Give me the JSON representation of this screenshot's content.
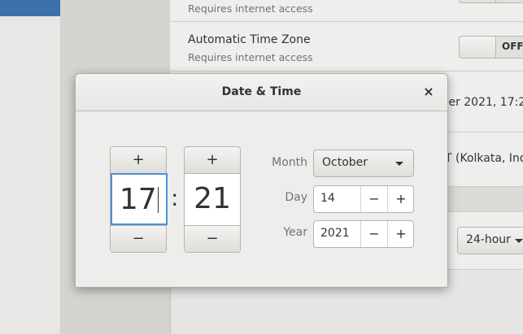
{
  "background": {
    "rows": [
      {
        "subtitle": "Requires internet access"
      },
      {
        "title": "Automatic Time Zone",
        "subtitle": "Requires internet access",
        "switch": "OFF"
      }
    ],
    "date_time_value": "ober 2021, 17:2",
    "timezone_value": "T (Kolkata, Indi",
    "time_format": "24-hour"
  },
  "dialog": {
    "title": "Date & Time",
    "close_glyph": "×",
    "time": {
      "hour": "17",
      "minute": "21",
      "separator": ":",
      "increment_glyph": "+",
      "decrement_glyph": "−"
    },
    "fields": {
      "month_label": "Month",
      "month_value": "October",
      "day_label": "Day",
      "day_value": "14",
      "year_label": "Year",
      "year_value": "2021",
      "minus_glyph": "−",
      "plus_glyph": "+"
    }
  },
  "colors": {
    "accent": "#4a90d9",
    "selection": "#3d6fa8"
  }
}
